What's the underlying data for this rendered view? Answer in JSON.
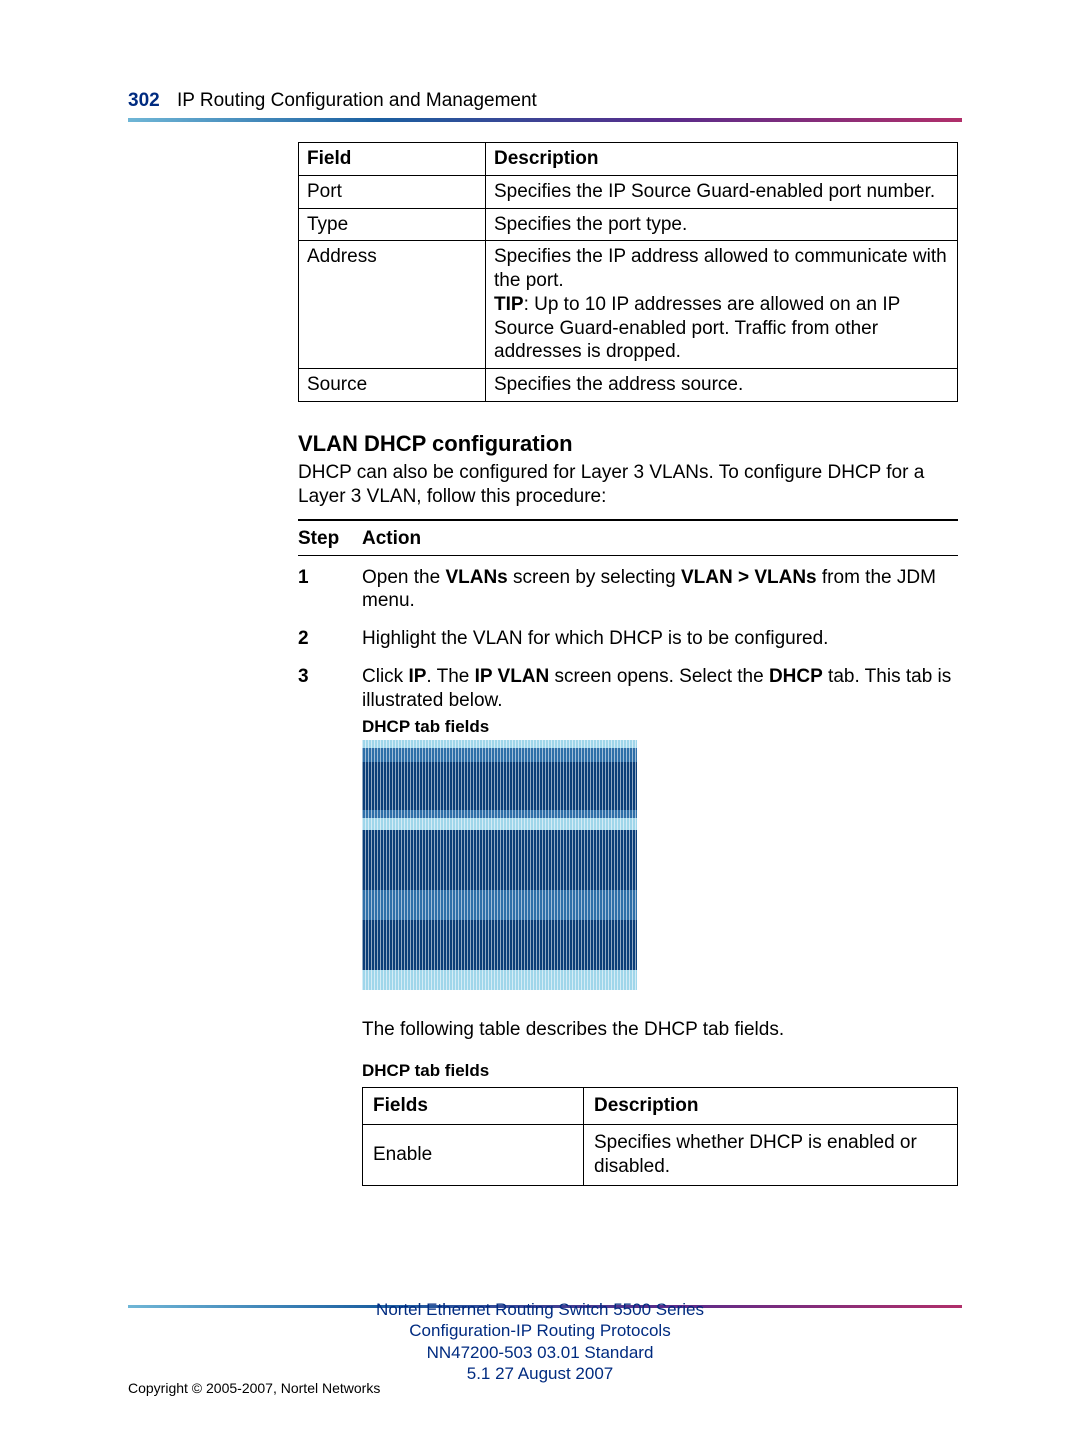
{
  "header": {
    "page_number": "302",
    "section": "IP Routing Configuration and Management"
  },
  "table1": {
    "col_field": "Field",
    "col_desc": "Description",
    "rows": [
      {
        "field": "Port",
        "desc": "Specifies the IP Source Guard-enabled port number."
      },
      {
        "field": "Type",
        "desc": "Specifies the port type."
      },
      {
        "field": "Address",
        "desc_pre": "Specifies the IP address allowed to communicate with the port.",
        "tip_label": "TIP",
        "tip_text": ": Up to 10 IP addresses are allowed on an IP Source Guard-enabled port.  Traffic from other addresses is dropped."
      },
      {
        "field": "Source",
        "desc": "Specifies the address source."
      }
    ]
  },
  "vlan_heading": "VLAN DHCP configuration",
  "vlan_intro": "DHCP can also be configured for Layer 3 VLANs.  To configure DHCP for a Layer 3 VLAN, follow this procedure:",
  "step_label": "Step",
  "action_label": "Action",
  "steps": {
    "s1": {
      "n": "1",
      "pre": "Open the ",
      "b1": "VLANs",
      "mid": " screen by selecting ",
      "b2": "VLAN > VLANs",
      "post": " from the JDM menu."
    },
    "s2": {
      "n": "2",
      "text": "Highlight the VLAN for which DHCP is to be configured."
    },
    "s3": {
      "n": "3",
      "pre": "Click ",
      "b1": "IP",
      "mid1": ".  The ",
      "b2": "IP VLAN",
      "mid2": " screen opens.  Select the ",
      "b3": "DHCP",
      "post": " tab.  This tab is illustrated below."
    }
  },
  "fig_caption": "DHCP tab fields",
  "after_fig": "The following table describes the DHCP tab fields.",
  "table2": {
    "caption": "DHCP tab fields",
    "col_fields": "Fields",
    "col_desc": "Description",
    "row1_field": "Enable",
    "row1_desc": "Specifies whether DHCP is enabled or disabled."
  },
  "footer": {
    "l1": "Nortel Ethernet Routing Switch 5500 Series",
    "l2": "Configuration-IP Routing Protocols",
    "l3": "NN47200-503   03.01   Standard",
    "l4": "5.1   27 August 2007"
  },
  "copyright": "Copyright © 2005-2007, Nortel Networks"
}
